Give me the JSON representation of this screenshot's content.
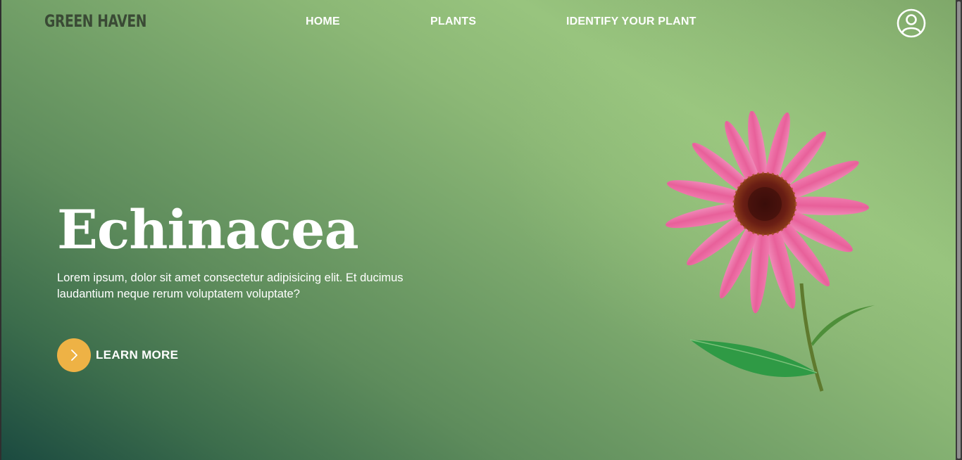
{
  "header": {
    "logo": "GREEN HAVEN",
    "nav": [
      {
        "label": "HOME"
      },
      {
        "label": "PLANTS"
      },
      {
        "label": "IDENTIFY YOUR PLANT"
      }
    ],
    "account_icon": "user-circle-icon"
  },
  "hero": {
    "title": "Echinacea",
    "description": "Lorem ipsum, dolor sit amet consectetur adipisicing elit. Et ducimus laudantium neque rerum voluptatem voluptate?",
    "cta_label": "LEARN MORE",
    "cta_icon": "chevron-right-icon",
    "image": "echinacea-flower"
  },
  "colors": {
    "accent": "#eeb245",
    "gradient_dark": "#1b4a40",
    "gradient_light": "#98c47e",
    "petal": "#ec6aa0",
    "flower_center": "#5a1a14"
  }
}
